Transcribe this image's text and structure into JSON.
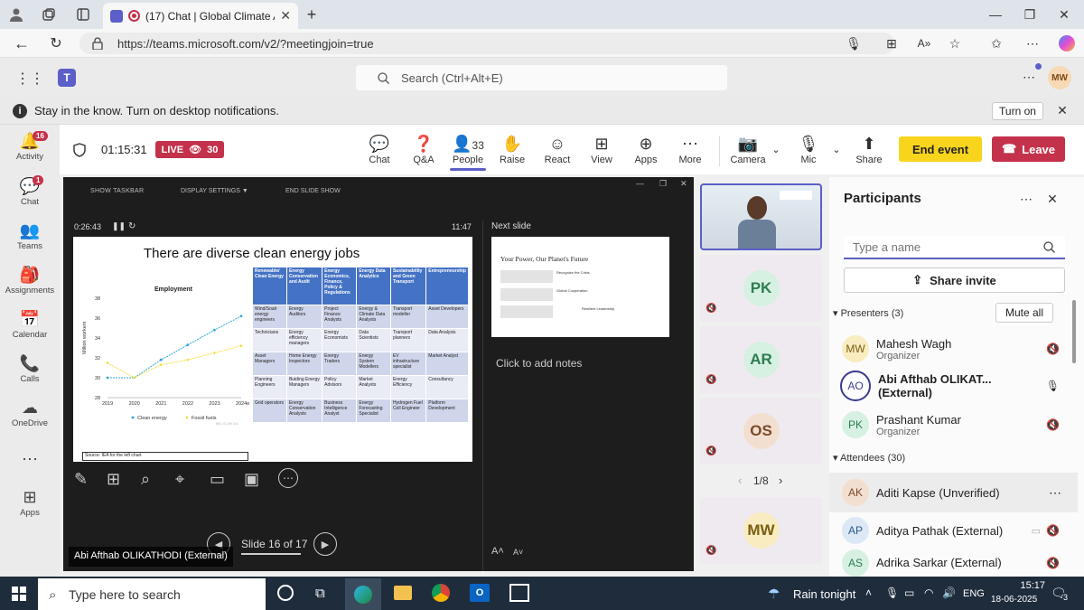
{
  "browser": {
    "tab_title": "(17) Chat | Global Climate Ac",
    "url": "https://teams.microsoft.com/v2/?meetingjoin=true"
  },
  "teams": {
    "search_placeholder": "Search (Ctrl+Alt+E)",
    "user_initials": "MW",
    "notification": "Stay in the know. Turn on desktop notifications.",
    "turn_on": "Turn on"
  },
  "rail": {
    "items": [
      {
        "label": "Activity",
        "badge": "16"
      },
      {
        "label": "Chat",
        "badge": "1"
      },
      {
        "label": "Teams"
      },
      {
        "label": "Assignments"
      },
      {
        "label": "Calendar"
      },
      {
        "label": "Calls"
      },
      {
        "label": "OneDrive"
      },
      {
        "label": "Apps"
      }
    ]
  },
  "meeting": {
    "timer": "01:15:31",
    "live": "LIVE",
    "viewers": "30",
    "people_count": "33",
    "toolbar": [
      "Chat",
      "Q&A",
      "People",
      "Raise",
      "React",
      "View",
      "Apps",
      "More",
      "Camera",
      "Mic",
      "Share"
    ],
    "end_event": "End event",
    "leave": "Leave"
  },
  "presenter_view": {
    "top_buttons": [
      "SHOW TASKBAR",
      "DISPLAY SETTINGS ▼",
      "END SLIDE SHOW"
    ],
    "elapsed": "0:26:43",
    "clock": "11:47",
    "next_slide_label": "Next slide",
    "notes_placeholder": "Click to add notes",
    "slide_counter": "Slide 16 of 17",
    "presenter_name": "Abi Afthab OLIKATHODI (External)"
  },
  "slide": {
    "title": "There are diverse clean energy jobs",
    "chart": {
      "title": "Employment",
      "ylabel": "Million workers",
      "years": [
        "2019",
        "2020",
        "2021",
        "2022",
        "2023",
        "2024e"
      ],
      "yticks": [
        "28",
        "30",
        "32",
        "34",
        "36",
        "38"
      ],
      "clean_energy": [
        30,
        30,
        31.8,
        33.3,
        34.8,
        36.2
      ],
      "fossil_fuels": [
        31.5,
        30,
        31.3,
        31.8,
        32.5,
        33.2
      ],
      "legend": [
        "Clean energy",
        "Fossil fuels"
      ],
      "credit": "IEA. CC BY 4.0.",
      "source": "Source: IEA for the left chart"
    },
    "table_headers": [
      "Renewable/ Clean Energy",
      "Energy Conservation and Audit",
      "Energy Economics, Finance, Policy & Regulations",
      "Energy Data Analytics",
      "Sustainability and Green Transport",
      "Entrepreneurship"
    ],
    "table_rows": [
      [
        "Wind/Soalr energy engineers",
        "Energy Auditors",
        "Project Finance Analysts",
        "Energy & Climate Data Analysts",
        "Transport modeller",
        "Asset Developers"
      ],
      [
        "Technicians",
        "Energy efficiency managers",
        "Energy Economists",
        "Data Scientists",
        "Transport planners",
        "Data Analysis"
      ],
      [
        "Asset Managers",
        "Home Energy Inspectors",
        "Energy Traders",
        "Energy System Modellers",
        "EV infrastructure specialist",
        "Market Analyst"
      ],
      [
        "Planning Engineers",
        "Buiding Energy Managers",
        "Policy Advisors",
        "Market Analysts",
        "Energy Efficiency",
        "Consultancy"
      ],
      [
        "Grid operators",
        "Energy Conservation Analysts",
        "Business Intelligence Analyst",
        "Energy Forecasting Specialist",
        "Hydrogen Fuel Cell Engineer",
        "Platform Development"
      ]
    ]
  },
  "next_slide": {
    "title": "Your Power, Our Planet's Future",
    "rows": [
      "Recognize the Crisis",
      "Global Cooperation",
      "Resilient Leadership"
    ]
  },
  "video": {
    "tiles": [
      {
        "initials": "PK",
        "bg": "#d6f0e2",
        "fg": "#2e7d4f"
      },
      {
        "initials": "AR",
        "bg": "#d6f0e2",
        "fg": "#2e7d4f"
      },
      {
        "initials": "OS",
        "bg": "#f3dfd0",
        "fg": "#7a4a28"
      },
      {
        "initials": "MW",
        "bg": "#f8ecc0",
        "fg": "#7a5d10"
      }
    ],
    "pager": "1/8"
  },
  "participants": {
    "title": "Participants",
    "search_placeholder": "Type a name",
    "share_invite": "Share invite",
    "presenters_label": "Presenters (3)",
    "mute_all": "Mute all",
    "attendees_label": "Attendees (30)",
    "presenters": [
      {
        "initials": "MW",
        "name": "Mahesh Wagh",
        "role": "Organizer"
      },
      {
        "initials": "AO",
        "name": "Abi Afthab OLIKAT...",
        "tag": "(External)"
      },
      {
        "initials": "PK",
        "name": "Prashant Kumar",
        "role": "Organizer"
      }
    ],
    "attendees": [
      {
        "initials": "AK",
        "name": "Aditi Kapse (Unverified)"
      },
      {
        "initials": "AP",
        "name": "Aditya Pathak (External)"
      },
      {
        "initials": "AS",
        "name": "Adrika Sarkar (External)"
      }
    ]
  },
  "taskbar": {
    "search_placeholder": "Type here to search",
    "weather": "Rain tonight",
    "language": "ENG",
    "time": "15:17",
    "date": "18-06-2025",
    "notif_count": "3"
  }
}
